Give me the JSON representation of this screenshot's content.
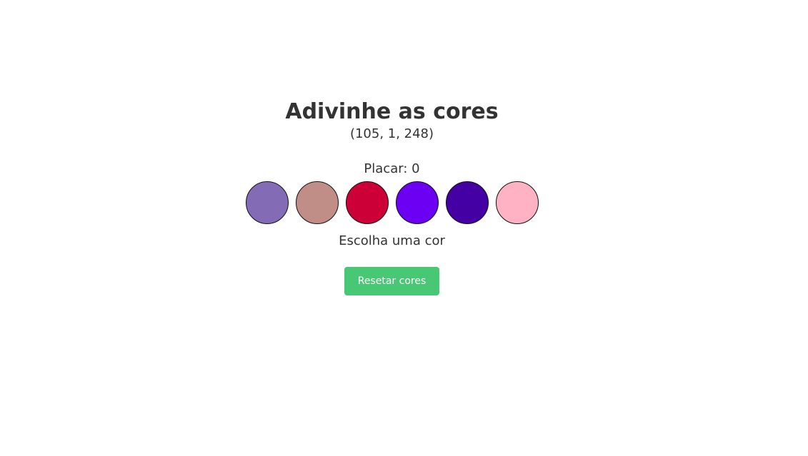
{
  "title": "Adivinhe as cores",
  "target_rgb": "(105, 1, 248)",
  "score": {
    "label": "Placar: 0"
  },
  "circles": [
    {
      "color": "#836bb5"
    },
    {
      "color": "#c08d87"
    },
    {
      "color": "#cc0036"
    },
    {
      "color": "#6b00f3"
    },
    {
      "color": "#4400a3"
    },
    {
      "color": "#ffb2c4"
    }
  ],
  "message": "Escolha uma cor",
  "reset_button": {
    "label": "Resetar cores",
    "color": "#48c774"
  }
}
